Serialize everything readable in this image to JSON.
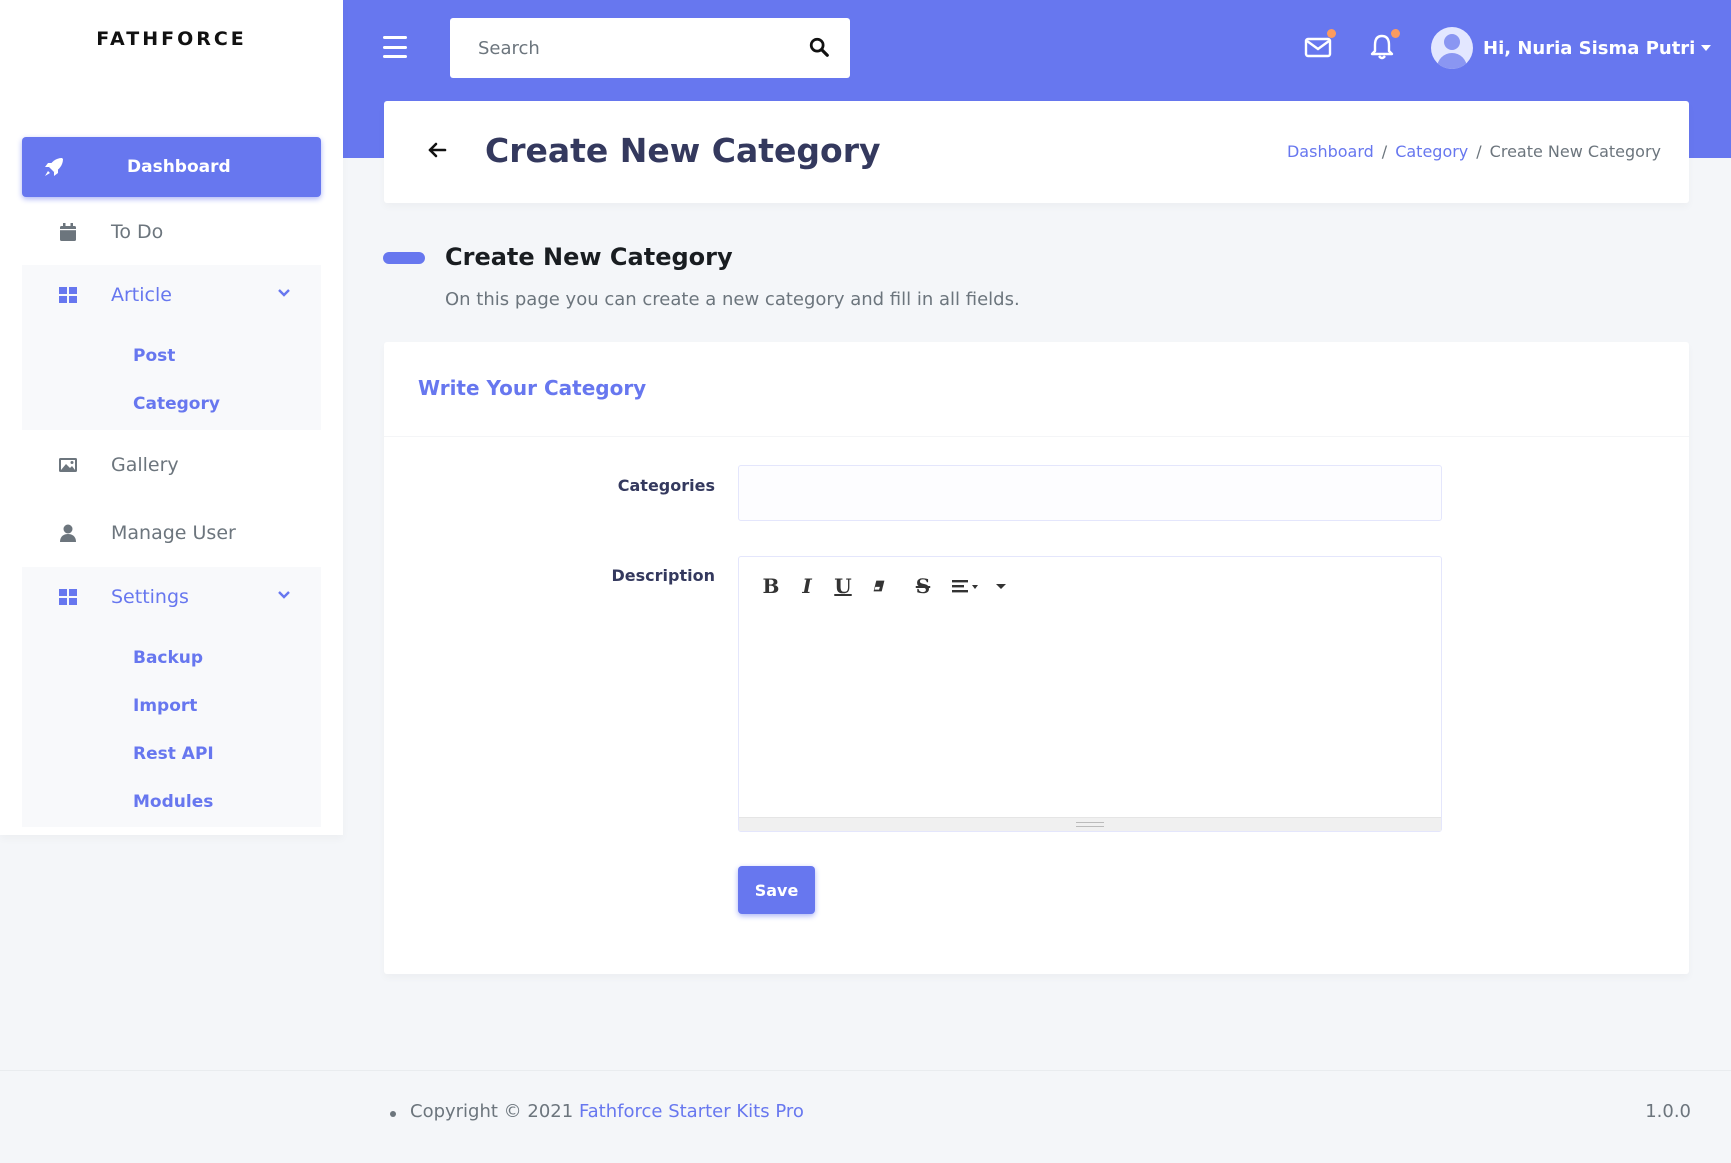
{
  "brand": "FATHFORCE",
  "search": {
    "placeholder": "Search"
  },
  "user": {
    "greeting": "Hi, Nuria Sisma Putri"
  },
  "sidebar": {
    "items": [
      {
        "label": "Dashboard",
        "icon": "rocket-icon",
        "active": true
      },
      {
        "label": "To Do",
        "icon": "calendar-icon"
      },
      {
        "label": "Article",
        "icon": "grid-icon",
        "children": [
          "Post",
          "Category"
        ]
      },
      {
        "label": "Gallery",
        "icon": "image-icon"
      },
      {
        "label": "Manage User",
        "icon": "user-icon"
      },
      {
        "label": "Settings",
        "icon": "grid-icon",
        "children": [
          "Backup",
          "Import",
          "Rest API",
          "Modules"
        ]
      }
    ]
  },
  "header": {
    "title": "Create New Category",
    "breadcrumb": [
      "Dashboard",
      "Category",
      "Create New Category"
    ],
    "separator": "/"
  },
  "section": {
    "title": "Create New Category",
    "lead": "On this page you can create a new category and fill in all fields."
  },
  "form": {
    "card_title": "Write Your Category",
    "categories_label": "Categories",
    "categories_value": "",
    "description_label": "Description",
    "toolbar": {
      "bold": "B",
      "italic": "I",
      "underline": "U",
      "strike": "S"
    },
    "save_label": "Save"
  },
  "footer": {
    "copyright": "Copyright © 2021",
    "link": "Fathforce Starter Kits Pro",
    "version": "1.0.0"
  },
  "colors": {
    "primary": "#6777ef",
    "notification_dot": "#fc9b5f",
    "background": "#f4f6f9"
  }
}
